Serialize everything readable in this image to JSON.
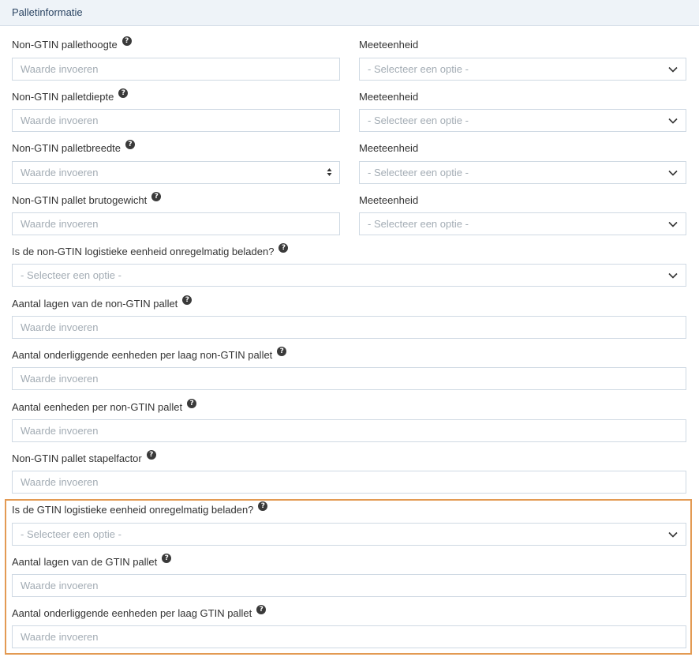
{
  "panel": {
    "title": "Palletinformatie"
  },
  "placeholders": {
    "input": "Waarde invoeren",
    "select": "- Selecteer een optie -"
  },
  "rows": [
    {
      "label": "Non-GTIN pallethoogte",
      "unit_label": "Meeteenheid"
    },
    {
      "label": "Non-GTIN palletdiepte",
      "unit_label": "Meeteenheid"
    },
    {
      "label": "Non-GTIN palletbreedte",
      "unit_label": "Meeteenheid"
    },
    {
      "label": "Non-GTIN pallet brutogewicht",
      "unit_label": "Meeteenheid"
    }
  ],
  "fields": [
    {
      "label": "Is de non-GTIN logistieke eenheid onregelmatig beladen?",
      "kind": "select"
    },
    {
      "label": "Aantal lagen van de non-GTIN pallet",
      "kind": "input"
    },
    {
      "label": "Aantal onderliggende eenheden per laag non-GTIN pallet",
      "kind": "input"
    },
    {
      "label": "Aantal eenheden per non-GTIN pallet",
      "kind": "input"
    },
    {
      "label": "Non-GTIN pallet stapelfactor",
      "kind": "input"
    },
    {
      "label": "Is de GTIN logistieke eenheid onregelmatig beladen?",
      "kind": "select"
    },
    {
      "label": "Aantal lagen van de GTIN pallet",
      "kind": "input"
    },
    {
      "label": "Aantal onderliggende eenheden per laag GTIN pallet",
      "kind": "input"
    }
  ],
  "help_icon_glyph": "?",
  "colors": {
    "highlight": "#e39a53",
    "header_bg": "#eef3f8",
    "input_border": "#cfd9e3"
  }
}
